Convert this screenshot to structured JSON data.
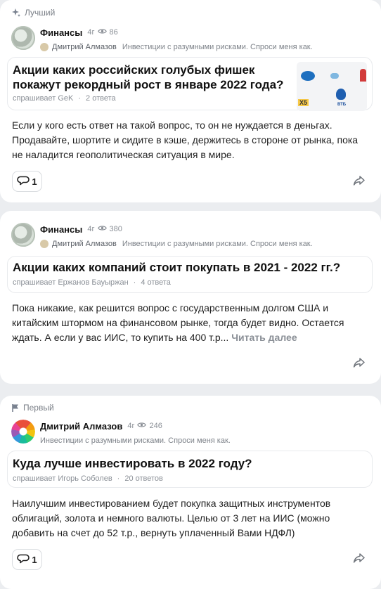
{
  "cards": [
    {
      "badge": {
        "label": "Лучший",
        "icon": "sparkle-icon"
      },
      "author": {
        "name": "Финансы",
        "age": "4г",
        "views": "86",
        "sub_name": "Дмитрий Алмазов",
        "sub_desc": "Инвестиции с разумными рисками. Спроси меня как."
      },
      "question": {
        "title": "Акции каких российских голубых фишек покажут рекордный рост в январе 2022 года?",
        "asker": "спрашивает GeK",
        "answers": "2 ответа",
        "image_labels": [
          "X5",
          "ВТБ"
        ]
      },
      "answer": "Если у кого есть ответ на такой вопрос, то он не нуждается в деньгах. Продавайте, шортите и сидите в кэше, держитесь в стороне от рынка, пока не наладится геополитическая ситуация в мире.",
      "comments": "1"
    },
    {
      "author": {
        "name": "Финансы",
        "age": "4г",
        "views": "380",
        "sub_name": "Дмитрий Алмазов",
        "sub_desc": "Инвестиции с разумными рисками. Спроси меня как."
      },
      "question": {
        "title": "Акции каких компаний стоит покупать в 2021 - 2022 гг.?",
        "asker": "спрашивает Ержанов Бауыржан",
        "answers": "4 ответа"
      },
      "answer": "Пока никакие, как решится вопрос с государственным долгом США и китайским штормом на финансовом рынке, тогда будет видно. Остается ждать. А если у вас ИИС, то купить на 400 т.р...",
      "read_more": "Читать далее"
    },
    {
      "badge": {
        "label": "Первый",
        "icon": "flag-icon"
      },
      "author": {
        "name": "Дмитрий Алмазов",
        "age": "4г",
        "views": "246",
        "desc": "Инвестиции с разумными рисками. Спроси меня как."
      },
      "question": {
        "title": "Куда лучше инвестировать в 2022 году?",
        "asker": "спрашивает Игорь Соболев",
        "answers": "20 ответов"
      },
      "answer": "Наилучшим инвестированием будет покупка защитных инструментов облигаций, золота и немного валюты. Целью от 3 лет на ИИС (можно добавить на счет до 52 т.р., вернуть уплаченный Вами НДФЛ)",
      "comments": "1"
    }
  ]
}
